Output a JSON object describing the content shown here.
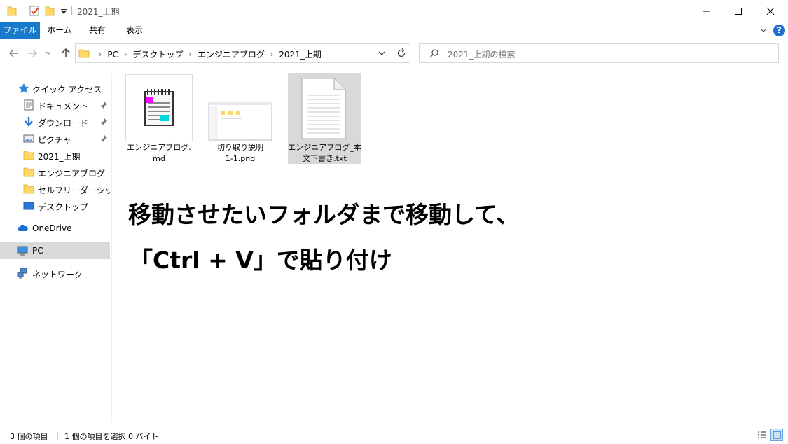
{
  "window": {
    "title": "2021_上期",
    "minimize_glyph": "—",
    "maximize_glyph": "☐",
    "close_glyph": "✕"
  },
  "ribbon": {
    "tabs": [
      "ファイル",
      "ホーム",
      "共有",
      "表示"
    ],
    "help_label": "?"
  },
  "address": {
    "crumbs": [
      "PC",
      "デスクトップ",
      "エンジニアブログ",
      "2021_上期"
    ]
  },
  "search": {
    "placeholder": "2021_上期の検索"
  },
  "sidebar": {
    "items": [
      {
        "label": "クイック アクセス",
        "icon": "star-icon",
        "pinned": false
      },
      {
        "label": "ドキュメント",
        "icon": "document-icon",
        "pinned": true
      },
      {
        "label": "ダウンロード",
        "icon": "download-arrow-icon",
        "pinned": true
      },
      {
        "label": "ピクチャ",
        "icon": "picture-icon",
        "pinned": true
      },
      {
        "label": "2021_上期",
        "icon": "folder-icon",
        "pinned": false
      },
      {
        "label": "エンジニアブログ",
        "icon": "folder-icon",
        "pinned": false
      },
      {
        "label": "セルフリーダーシップ研修",
        "icon": "folder-icon",
        "pinned": false
      },
      {
        "label": "デスクトップ",
        "icon": "desktop-icon",
        "pinned": false
      },
      {
        "label": "OneDrive",
        "icon": "cloud-icon",
        "pinned": false
      },
      {
        "label": "PC",
        "icon": "computer-icon",
        "pinned": false,
        "selected": true
      },
      {
        "label": "ネットワーク",
        "icon": "network-icon",
        "pinned": false
      }
    ]
  },
  "files": [
    {
      "name_line1": "エンジニアブログ.",
      "name_line2": "md",
      "icon": "notepad-md-icon"
    },
    {
      "name_line1": "切り取り説明",
      "name_line2": "1-1.png",
      "icon": "screenshot-thumbnail"
    },
    {
      "name_line1": "エンジニアブログ_本",
      "name_line2": "文下書き.txt",
      "icon": "text-file-icon",
      "selected": true
    }
  ],
  "overlay": {
    "line1": "移動させたいフォルダまで移動して、",
    "line2": "「Ctrl + V」で貼り付け"
  },
  "status": {
    "item_count": "3 個の項目",
    "selection": "1 個の項目を選択  0 バイト"
  },
  "colors": {
    "file_tab": "#1979ca",
    "selection": "#d9d9d9",
    "folder": "#ffd866"
  }
}
